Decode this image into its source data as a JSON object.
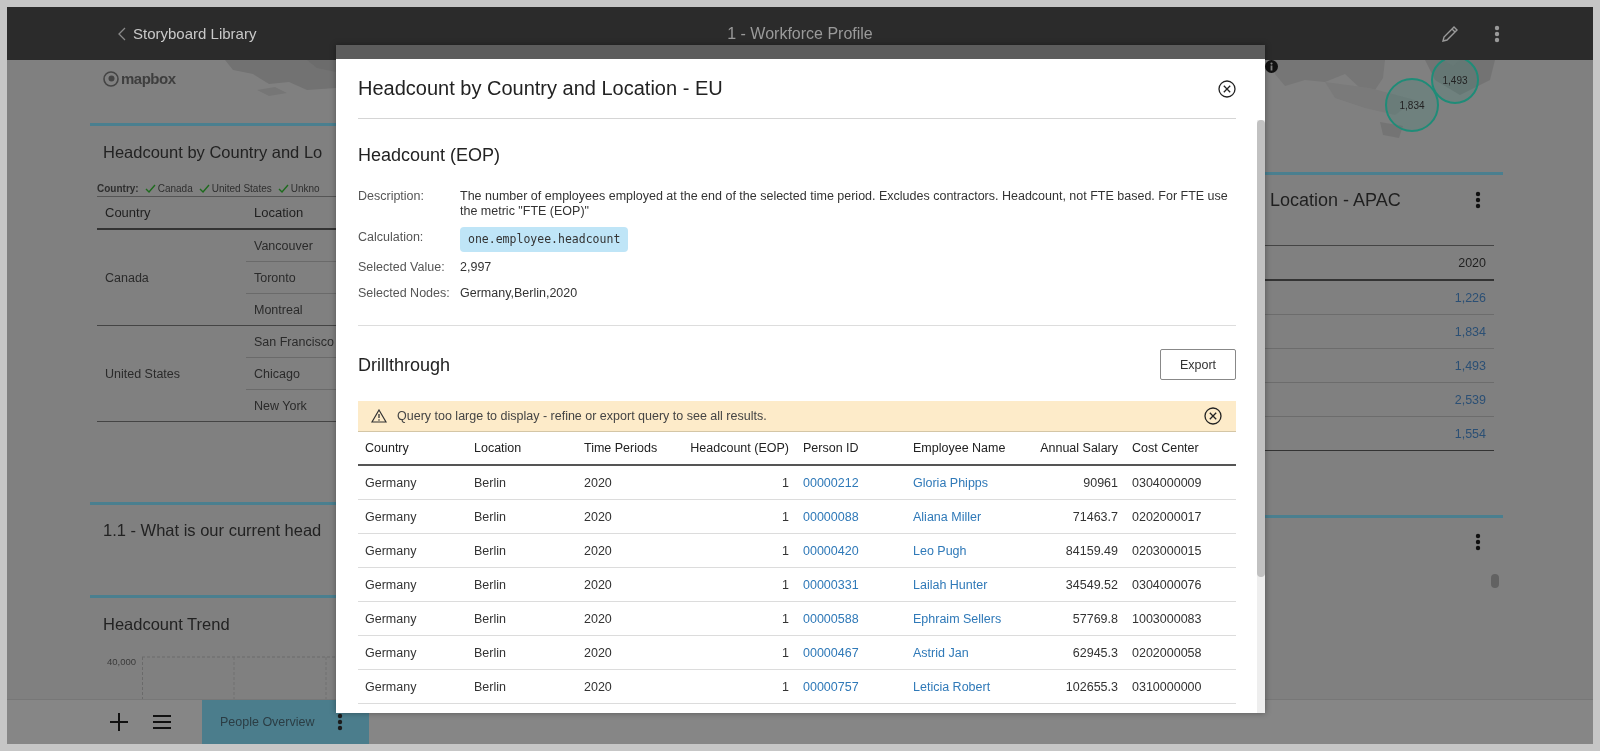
{
  "header": {
    "back_label": "Storyboard Library",
    "title": "1 - Workforce Profile"
  },
  "left_panel": {
    "map_attribution": "mapbox",
    "card": {
      "title": "Headcount by Country and Lo",
      "filter": {
        "label": "Country:",
        "values": [
          {
            "label": "Canada",
            "checked": true
          },
          {
            "label": "United States",
            "checked": true
          },
          {
            "label": "Unkno",
            "checked": true
          }
        ]
      },
      "columns": [
        "Country",
        "Location"
      ],
      "groups": [
        {
          "country": "Canada",
          "locations": [
            "Vancouver",
            "Toronto",
            "Montreal"
          ]
        },
        {
          "country": "United States",
          "locations": [
            "San Francisco",
            "Chicago",
            "New York"
          ]
        }
      ]
    },
    "question_card": {
      "title": "1.1 - What is our current head"
    },
    "trend_card": {
      "title": "Headcount Trend",
      "y_tick": "40,000"
    }
  },
  "right_panel": {
    "map_bubbles": [
      "1,493",
      "1,834"
    ],
    "card": {
      "title": "Location - APAC",
      "column": "2020",
      "values": [
        "1,226",
        "1,834",
        "1,493",
        "2,539",
        "1,554"
      ]
    }
  },
  "bottom_bar": {
    "tabs": [
      {
        "label": "People Overview",
        "selected": true
      }
    ]
  },
  "modal": {
    "title": "Headcount by Country and Location - EU",
    "metric": {
      "title": "Headcount (EOP)",
      "fields": [
        {
          "label": "Description:",
          "value": "The number of employees employed at the end of the selected time period. Excludes contractors. Headcount, not FTE based. For FTE use the metric \"FTE (EOP)\"",
          "kind": "text"
        },
        {
          "label": "Calculation:",
          "value": "one.employee.headcount",
          "kind": "code"
        },
        {
          "label": "Selected Value:",
          "value": "2,997",
          "kind": "text"
        },
        {
          "label": "Selected Nodes:",
          "value": "Germany,Berlin,2020",
          "kind": "text"
        }
      ]
    },
    "drillthrough": {
      "title": "Drillthrough",
      "export_label": "Export",
      "warning": "Query too large to display - refine or export query to see all results.",
      "columns": [
        {
          "label": "Country",
          "kind": "text"
        },
        {
          "label": "Location",
          "kind": "text"
        },
        {
          "label": "Time Periods",
          "kind": "text"
        },
        {
          "label": "Headcount (EOP)",
          "kind": "number"
        },
        {
          "label": "Person ID",
          "kind": "link"
        },
        {
          "label": "Employee Name",
          "kind": "link"
        },
        {
          "label": "Annual Salary",
          "kind": "number"
        },
        {
          "label": "Cost Center",
          "kind": "text"
        }
      ],
      "rows": [
        [
          "Germany",
          "Berlin",
          "2020",
          "1",
          "00000212",
          "Gloria Phipps",
          "90961",
          "0304000009"
        ],
        [
          "Germany",
          "Berlin",
          "2020",
          "1",
          "00000088",
          "Aliana Miller",
          "71463.7",
          "0202000017"
        ],
        [
          "Germany",
          "Berlin",
          "2020",
          "1",
          "00000420",
          "Leo Pugh",
          "84159.49",
          "0203000015"
        ],
        [
          "Germany",
          "Berlin",
          "2020",
          "1",
          "00000331",
          "Lailah Hunter",
          "34549.52",
          "0304000076"
        ],
        [
          "Germany",
          "Berlin",
          "2020",
          "1",
          "00000588",
          "Ephraim Sellers",
          "57769.8",
          "1003000083"
        ],
        [
          "Germany",
          "Berlin",
          "2020",
          "1",
          "00000467",
          "Astrid Jan",
          "62945.3",
          "0202000058"
        ],
        [
          "Germany",
          "Berlin",
          "2020",
          "1",
          "00000757",
          "Leticia Robert",
          "102655.3",
          "0310000000"
        ]
      ]
    }
  }
}
